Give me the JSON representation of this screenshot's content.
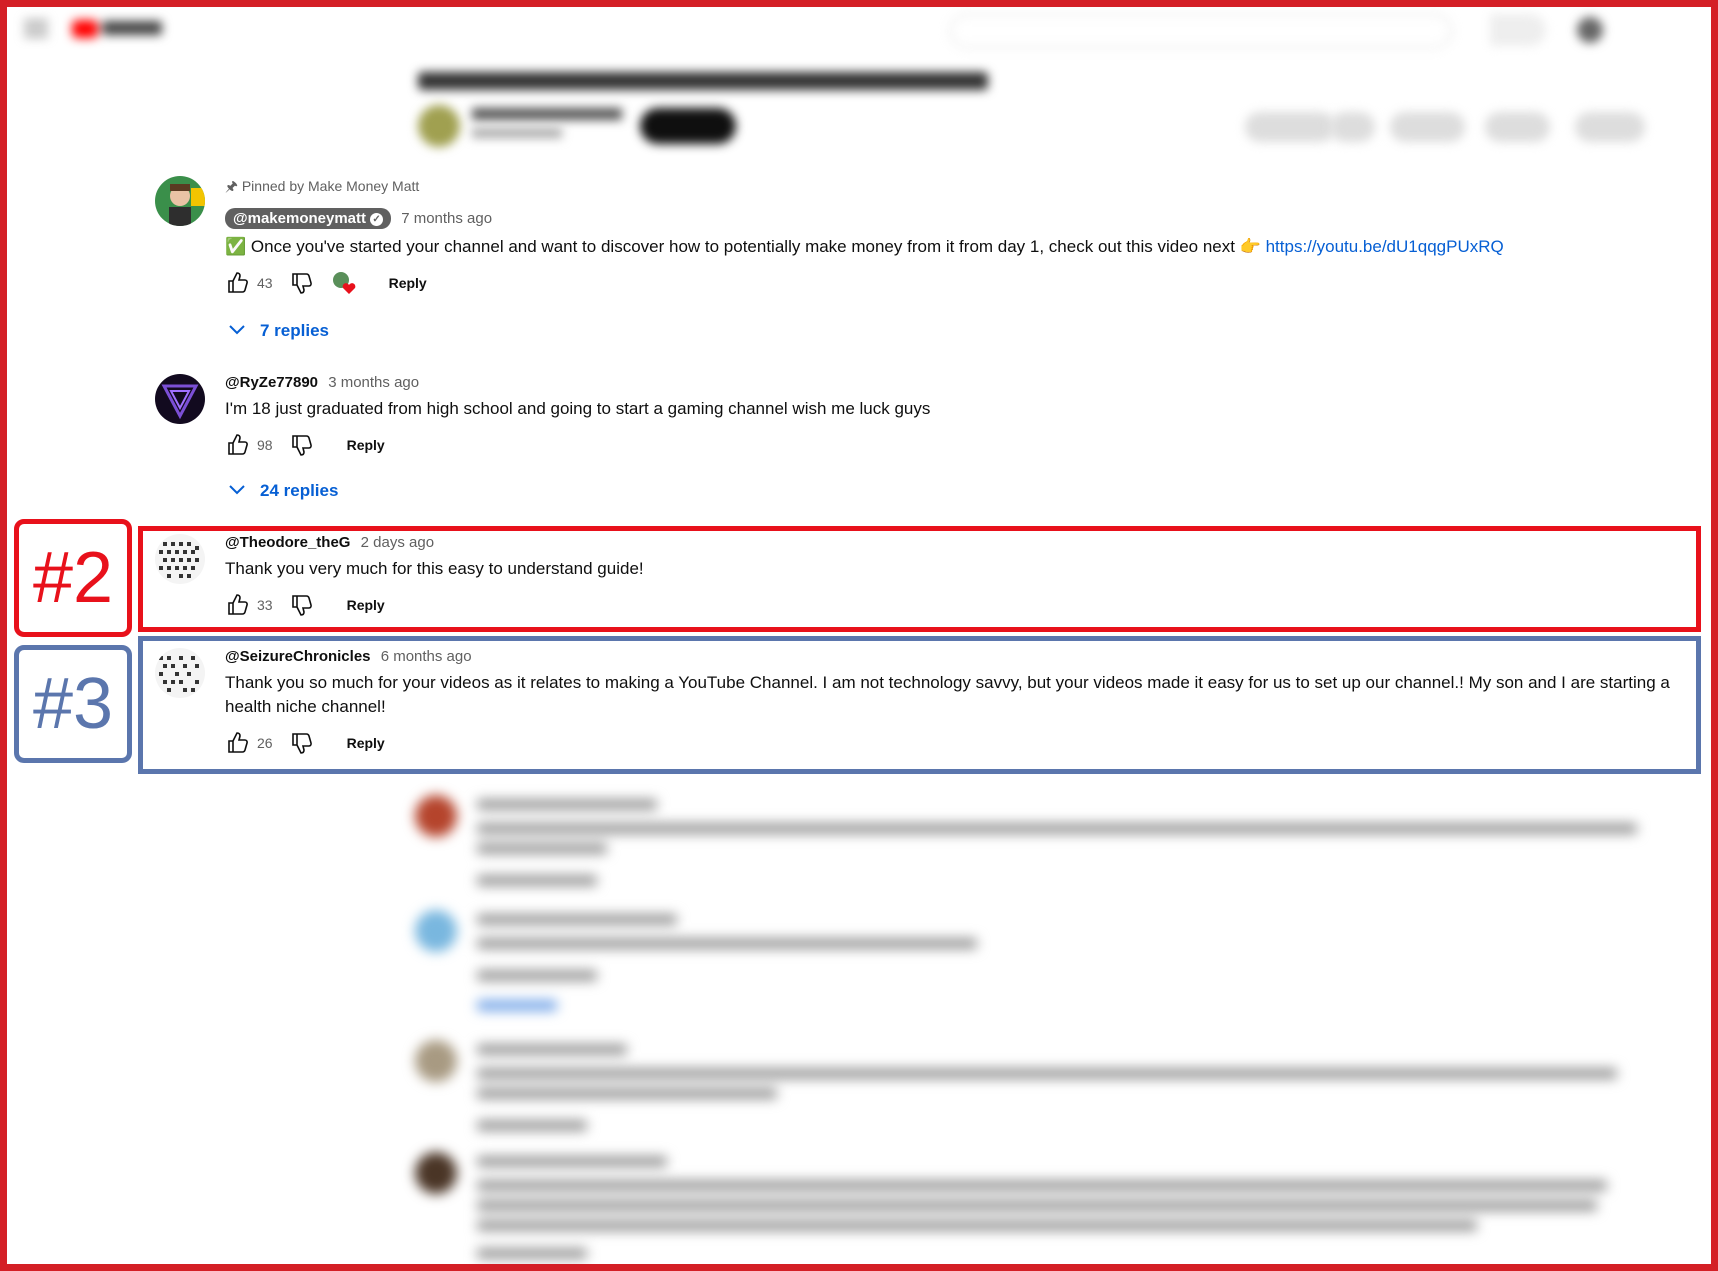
{
  "colors": {
    "frame": "#d41f26",
    "highlight_red": "#e8111b",
    "highlight_blue": "#5b76ad",
    "link": "#065fd4",
    "muted": "#606060"
  },
  "badges": {
    "red": "#2",
    "blue": "#3"
  },
  "comments": [
    {
      "pinned_label": "Pinned by Make Money Matt",
      "author": "@makemoneymatt",
      "time": "7 months ago",
      "text_prefix": "✅ Once you've started your channel and want to discover how to potentially make money from it from day 1, check out this video next 👉 ",
      "link": "https://youtu.be/dU1qqgPUxRQ",
      "likes": "43",
      "reply_label": "Reply",
      "replies_label": "7 replies",
      "avatar_icon": "person-avatar",
      "heart_icon": "creator-heart-icon"
    },
    {
      "author": "@RyZe77890",
      "time": "3 months ago",
      "text": "I'm 18 just graduated from high school and going to start a gaming channel wish me luck guys",
      "likes": "98",
      "reply_label": "Reply",
      "replies_label": "24 replies",
      "avatar_icon": "triangle-logo-avatar"
    },
    {
      "author": "@Theodore_theG",
      "time": "2 days ago",
      "text": "Thank you very much for this easy to understand guide!",
      "likes": "33",
      "reply_label": "Reply",
      "avatar_icon": "pixel-pattern-avatar"
    },
    {
      "author": "@SeizureChronicles",
      "time": "6 months ago",
      "text": "Thank you so much for your videos as it relates to making a YouTube Channel. I am not technology savvy, but your videos made it easy for us to set up our channel.! My son and I are starting a health niche channel!",
      "likes": "26",
      "reply_label": "Reply",
      "avatar_icon": "pixel-pattern-avatar"
    }
  ]
}
